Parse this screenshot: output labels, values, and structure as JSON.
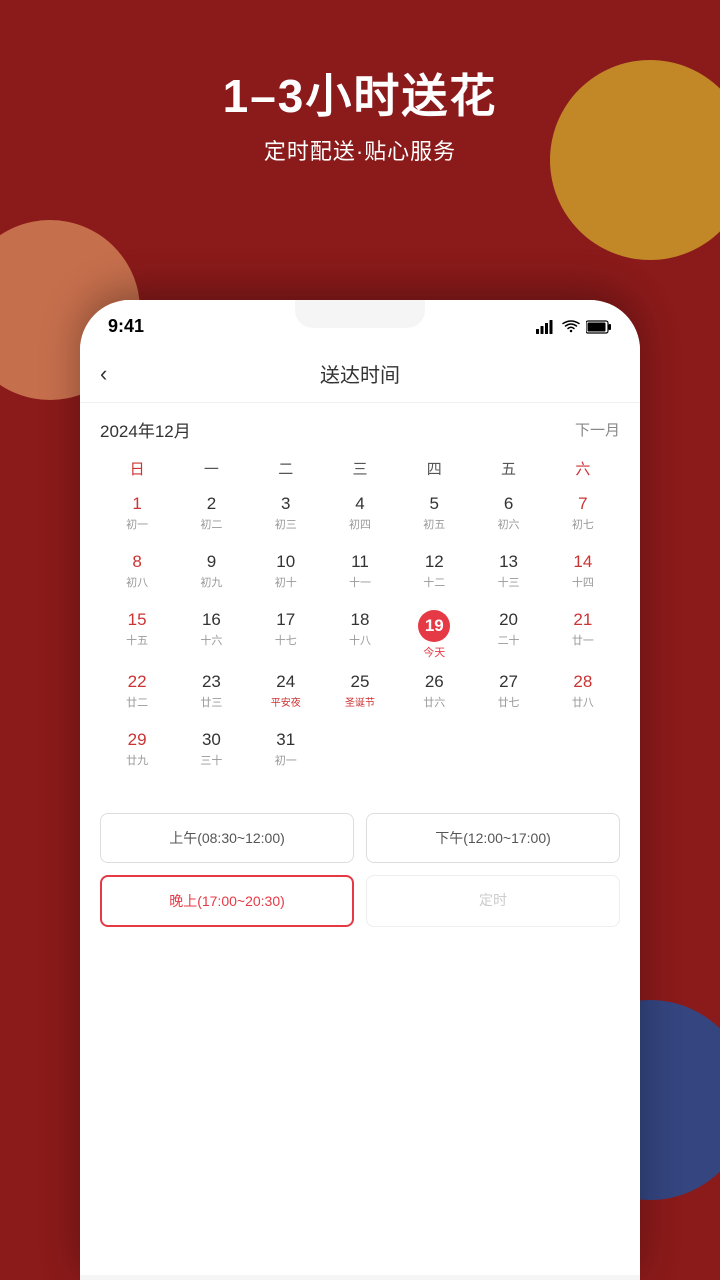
{
  "background": {
    "color": "#8B1A1A"
  },
  "header": {
    "title": "1–3小时送花",
    "subtitle": "定时配送·贴心服务"
  },
  "status_bar": {
    "time": "9:41",
    "signal": "signal-icon",
    "wifi": "wifi-icon",
    "battery": "battery-icon"
  },
  "nav": {
    "back_label": "‹",
    "title": "送达时间",
    "next_month_label": "下一月"
  },
  "calendar": {
    "month_year": "2024年12月",
    "day_headers": [
      {
        "label": "日",
        "class": "sun"
      },
      {
        "label": "一",
        "class": ""
      },
      {
        "label": "二",
        "class": ""
      },
      {
        "label": "三",
        "class": ""
      },
      {
        "label": "四",
        "class": ""
      },
      {
        "label": "五",
        "class": ""
      },
      {
        "label": "六",
        "class": "sat"
      }
    ],
    "weeks": [
      [
        {
          "day": "1",
          "lunar": "初一",
          "grayed": false,
          "red": false,
          "today": false,
          "holiday": ""
        },
        {
          "day": "2",
          "lunar": "初二",
          "grayed": false,
          "red": false,
          "today": false,
          "holiday": ""
        },
        {
          "day": "3",
          "lunar": "初三",
          "grayed": false,
          "red": false,
          "today": false,
          "holiday": ""
        },
        {
          "day": "4",
          "lunar": "初四",
          "grayed": false,
          "red": false,
          "today": false,
          "holiday": ""
        },
        {
          "day": "5",
          "lunar": "初五",
          "grayed": false,
          "red": false,
          "today": false,
          "holiday": ""
        },
        {
          "day": "6",
          "lunar": "初六",
          "grayed": false,
          "red": false,
          "today": false,
          "holiday": ""
        },
        {
          "day": "7",
          "lunar": "初七",
          "grayed": false,
          "red": true,
          "today": false,
          "holiday": ""
        }
      ],
      [
        {
          "day": "8",
          "lunar": "初八",
          "grayed": false,
          "red": false,
          "today": false,
          "holiday": ""
        },
        {
          "day": "9",
          "lunar": "初九",
          "grayed": false,
          "red": false,
          "today": false,
          "holiday": ""
        },
        {
          "day": "10",
          "lunar": "初十",
          "grayed": false,
          "red": false,
          "today": false,
          "holiday": ""
        },
        {
          "day": "11",
          "lunar": "十一",
          "grayed": false,
          "red": false,
          "today": false,
          "holiday": ""
        },
        {
          "day": "12",
          "lunar": "十二",
          "grayed": false,
          "red": false,
          "today": false,
          "holiday": ""
        },
        {
          "day": "13",
          "lunar": "十三",
          "grayed": false,
          "red": false,
          "today": false,
          "holiday": ""
        },
        {
          "day": "14",
          "lunar": "十四",
          "grayed": false,
          "red": true,
          "today": false,
          "holiday": ""
        }
      ],
      [
        {
          "day": "15",
          "lunar": "十五",
          "grayed": false,
          "red": false,
          "today": false,
          "holiday": ""
        },
        {
          "day": "16",
          "lunar": "十六",
          "grayed": false,
          "red": false,
          "today": false,
          "holiday": ""
        },
        {
          "day": "17",
          "lunar": "十七",
          "grayed": false,
          "red": false,
          "today": false,
          "holiday": ""
        },
        {
          "day": "18",
          "lunar": "十八",
          "grayed": false,
          "red": false,
          "today": false,
          "holiday": ""
        },
        {
          "day": "19",
          "lunar": "今天",
          "grayed": false,
          "red": false,
          "today": true,
          "holiday": ""
        },
        {
          "day": "20",
          "lunar": "二十",
          "grayed": false,
          "red": false,
          "today": false,
          "holiday": ""
        },
        {
          "day": "21",
          "lunar": "廿一",
          "grayed": false,
          "red": true,
          "today": false,
          "holiday": ""
        }
      ],
      [
        {
          "day": "22",
          "lunar": "廿二",
          "grayed": false,
          "red": false,
          "today": false,
          "holiday": ""
        },
        {
          "day": "23",
          "lunar": "廿三",
          "grayed": false,
          "red": false,
          "today": false,
          "holiday": ""
        },
        {
          "day": "24",
          "lunar": "平安夜",
          "grayed": false,
          "red": false,
          "today": false,
          "holiday": "平安夜"
        },
        {
          "day": "25",
          "lunar": "圣诞节",
          "grayed": false,
          "red": false,
          "today": false,
          "holiday": "圣诞节"
        },
        {
          "day": "26",
          "lunar": "廿六",
          "grayed": false,
          "red": false,
          "today": false,
          "holiday": ""
        },
        {
          "day": "27",
          "lunar": "廿七",
          "grayed": false,
          "red": false,
          "today": false,
          "holiday": ""
        },
        {
          "day": "28",
          "lunar": "廿八",
          "grayed": false,
          "red": true,
          "today": false,
          "holiday": ""
        }
      ],
      [
        {
          "day": "29",
          "lunar": "廿九",
          "grayed": false,
          "red": false,
          "today": false,
          "holiday": ""
        },
        {
          "day": "30",
          "lunar": "三十",
          "grayed": false,
          "red": false,
          "today": false,
          "holiday": ""
        },
        {
          "day": "31",
          "lunar": "初一",
          "grayed": false,
          "red": false,
          "today": false,
          "holiday": ""
        },
        {
          "day": "",
          "lunar": "",
          "grayed": true,
          "red": false,
          "today": false,
          "holiday": ""
        },
        {
          "day": "",
          "lunar": "",
          "grayed": true,
          "red": false,
          "today": false,
          "holiday": ""
        },
        {
          "day": "",
          "lunar": "",
          "grayed": true,
          "red": false,
          "today": false,
          "holiday": ""
        },
        {
          "day": "",
          "lunar": "",
          "grayed": true,
          "red": false,
          "today": false,
          "holiday": ""
        }
      ]
    ]
  },
  "time_slots": [
    {
      "label": "上午(08:30~12:00)",
      "selected": false,
      "grayed": false
    },
    {
      "label": "下午(12:00~17:00)",
      "selected": false,
      "grayed": false
    },
    {
      "label": "晚上(17:00~20:30)",
      "selected": true,
      "grayed": false
    },
    {
      "label": "定时",
      "selected": false,
      "grayed": true
    }
  ]
}
